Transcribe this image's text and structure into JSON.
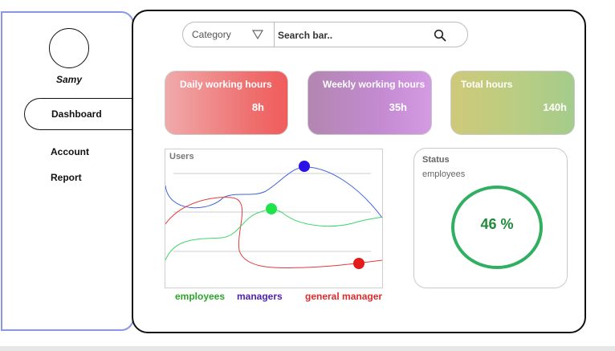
{
  "sidebar": {
    "username": "Samy",
    "items": [
      {
        "label": "Dashboard",
        "active": true
      },
      {
        "label": "Account"
      },
      {
        "label": "Report"
      }
    ]
  },
  "search": {
    "category_label": "Category",
    "placeholder": "Search bar.."
  },
  "stats": [
    {
      "title": "Daily working hours",
      "value": "8h"
    },
    {
      "title": "Weekly working hours",
      "value": "35h"
    },
    {
      "title": "Total hours",
      "value": "140h"
    }
  ],
  "users_chart": {
    "title": "Users",
    "legend": [
      {
        "label": "employees",
        "color": "#2aa52a"
      },
      {
        "label": "managers",
        "color": "#4b1fb3"
      },
      {
        "label": "general manager",
        "color": "#e02a2a"
      }
    ]
  },
  "status": {
    "title": "Status",
    "subtitle": "employees",
    "value": "46 %",
    "percent": 46
  },
  "icons": {
    "category_arrow": "triangle-down-icon",
    "search": "search-icon"
  }
}
